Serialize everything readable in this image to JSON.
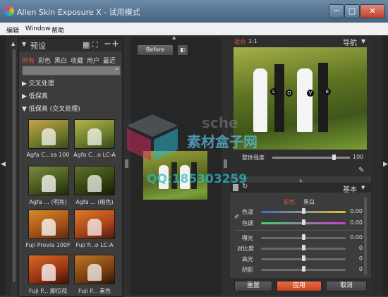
{
  "window": {
    "title": "Alien Skin Exposure X - 试用模式"
  },
  "menu": [
    "编辑",
    "Window",
    "帮助"
  ],
  "left_panel": {
    "title": "预设",
    "tabs": [
      "所有",
      "彩色",
      "黑白",
      "收藏",
      "用户",
      "最近"
    ],
    "tree": [
      "交叉处理",
      "低保真",
      "低保真 (交叉处理)"
    ],
    "presets": [
      "Agfa C...sa 100",
      "Agfa C...o LC-A",
      "Agfa ... (明亮)",
      "Agfa ... (暗色)",
      "Fuji Provia 100F",
      "Fuji P...o LC-A",
      "Fuji P... 脚位视",
      "Fuji P... 素色"
    ]
  },
  "center": {
    "before_label": "Before"
  },
  "navigator": {
    "fit_label": "适合",
    "zoom_label": "1:1",
    "title": "导航",
    "overall_intensity_label": "整体强度",
    "overall_intensity_value": "100"
  },
  "basic": {
    "title": "基本",
    "color_tab": "彩色",
    "bw_tab": "黑白",
    "rows": [
      {
        "label": "色温",
        "value": "0.00"
      },
      {
        "label": "色调",
        "value": "0.00"
      },
      {
        "label": "曝光",
        "value": "0.00"
      },
      {
        "label": "对比度",
        "value": "0"
      },
      {
        "label": "高光",
        "value": "0"
      },
      {
        "label": "阴影",
        "value": "0"
      }
    ]
  },
  "buttons": {
    "reset": "重置",
    "apply": "应用",
    "cancel": "取消"
  },
  "watermark": {
    "line1": "sche",
    "line2": "素材盒子网",
    "line3": "QQ:185303259"
  },
  "colors": {
    "accent": "#e2583e",
    "apply": "#d8552f"
  }
}
